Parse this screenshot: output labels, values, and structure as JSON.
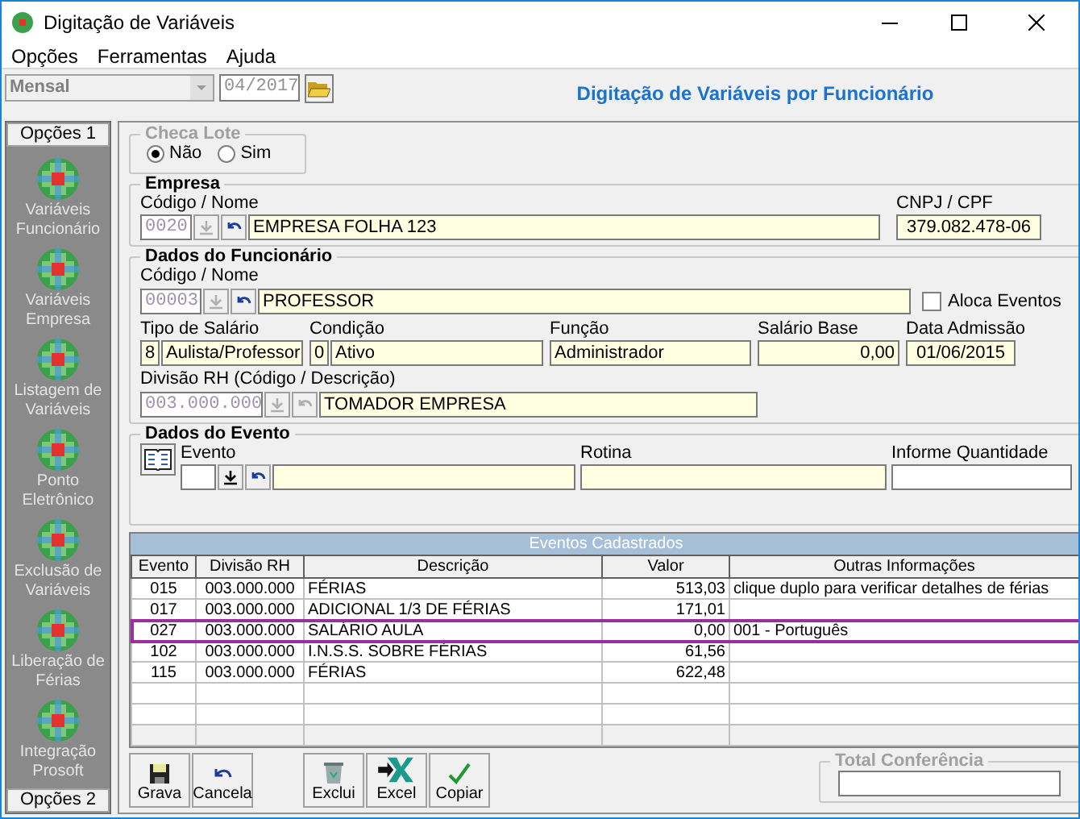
{
  "window": {
    "title": "Digitação de Variáveis"
  },
  "menu": [
    "Opções",
    "Ferramentas",
    "Ajuda"
  ],
  "toolbar": {
    "period": "Mensal",
    "competence": "04/2017",
    "heading": "Digitação de Variáveis por Funcionário"
  },
  "sidebar": {
    "top_tab": "Opções 1",
    "items": [
      "Variáveis Funcionário",
      "Variáveis Empresa",
      "Listagem de Variáveis",
      "Ponto Eletrônico",
      "Exclusão de Variáveis",
      "Liberação de Férias",
      "Integração Prosoft"
    ],
    "bottom_tab": "Opções 2"
  },
  "checa_lote": {
    "title": "Checa Lote",
    "options": [
      {
        "label": "Não",
        "selected": true
      },
      {
        "label": "Sim",
        "selected": false
      }
    ]
  },
  "empresa": {
    "title": "Empresa",
    "code_label": "Código / Nome",
    "code": "0020",
    "name": "EMPRESA FOLHA 123",
    "cnpj_label": "CNPJ / CPF",
    "cnpj": "379.082.478-06"
  },
  "funcionario": {
    "title": "Dados do Funcionário",
    "code_label": "Código / Nome",
    "code": "00003",
    "name": "PROFESSOR",
    "aloca_label": "Aloca Eventos",
    "aloca_checked": false,
    "tipo_label": "Tipo de Salário",
    "tipo_code": "8",
    "tipo": "Aulista/Professor",
    "condicao_label": "Condição",
    "condicao_code": "0",
    "condicao": "Ativo",
    "funcao_label": "Função",
    "funcao": "Administrador",
    "salario_label": "Salário Base",
    "salario": "0,00",
    "admissao_label": "Data Admissão",
    "admissao": "01/06/2015",
    "divisao_label": "Divisão RH (Código / Descrição)",
    "divisao_code": "003.000.000",
    "divisao": "TOMADOR EMPRESA"
  },
  "evento": {
    "title": "Dados do Evento",
    "evento_label": "Evento",
    "rotina_label": "Rotina",
    "quantidade_label": "Informe Quantidade"
  },
  "table": {
    "title": "Eventos Cadastrados",
    "columns": [
      "Evento",
      "Divisão RH",
      "Descrição",
      "Valor",
      "Outras Informações"
    ],
    "rows": [
      {
        "cells": [
          "015",
          "003.000.000",
          "FÉRIAS",
          "513,03",
          "clique duplo para verificar detalhes de férias"
        ],
        "selected": false
      },
      {
        "cells": [
          "017",
          "003.000.000",
          "ADICIONAL 1/3 DE FÉRIAS",
          "171,01",
          ""
        ],
        "selected": false
      },
      {
        "cells": [
          "027",
          "003.000.000",
          "SALÁRIO AULA",
          "0,00",
          "001 - Português"
        ],
        "selected": true
      },
      {
        "cells": [
          "102",
          "003.000.000",
          "I.N.S.S. SOBRE FÉRIAS",
          "61,56",
          ""
        ],
        "selected": false
      },
      {
        "cells": [
          "115",
          "003.000.000",
          "FÉRIAS",
          "622,48",
          ""
        ],
        "selected": false
      }
    ]
  },
  "buttons": [
    {
      "label": "Grava",
      "kind": "save"
    },
    {
      "label": "Cancela",
      "kind": "undo"
    },
    {
      "label": "Exclui",
      "kind": "trash"
    },
    {
      "label": "Excel",
      "kind": "excel"
    },
    {
      "label": "Copiar",
      "kind": "check"
    }
  ],
  "total": {
    "title": "Total Conferência"
  }
}
